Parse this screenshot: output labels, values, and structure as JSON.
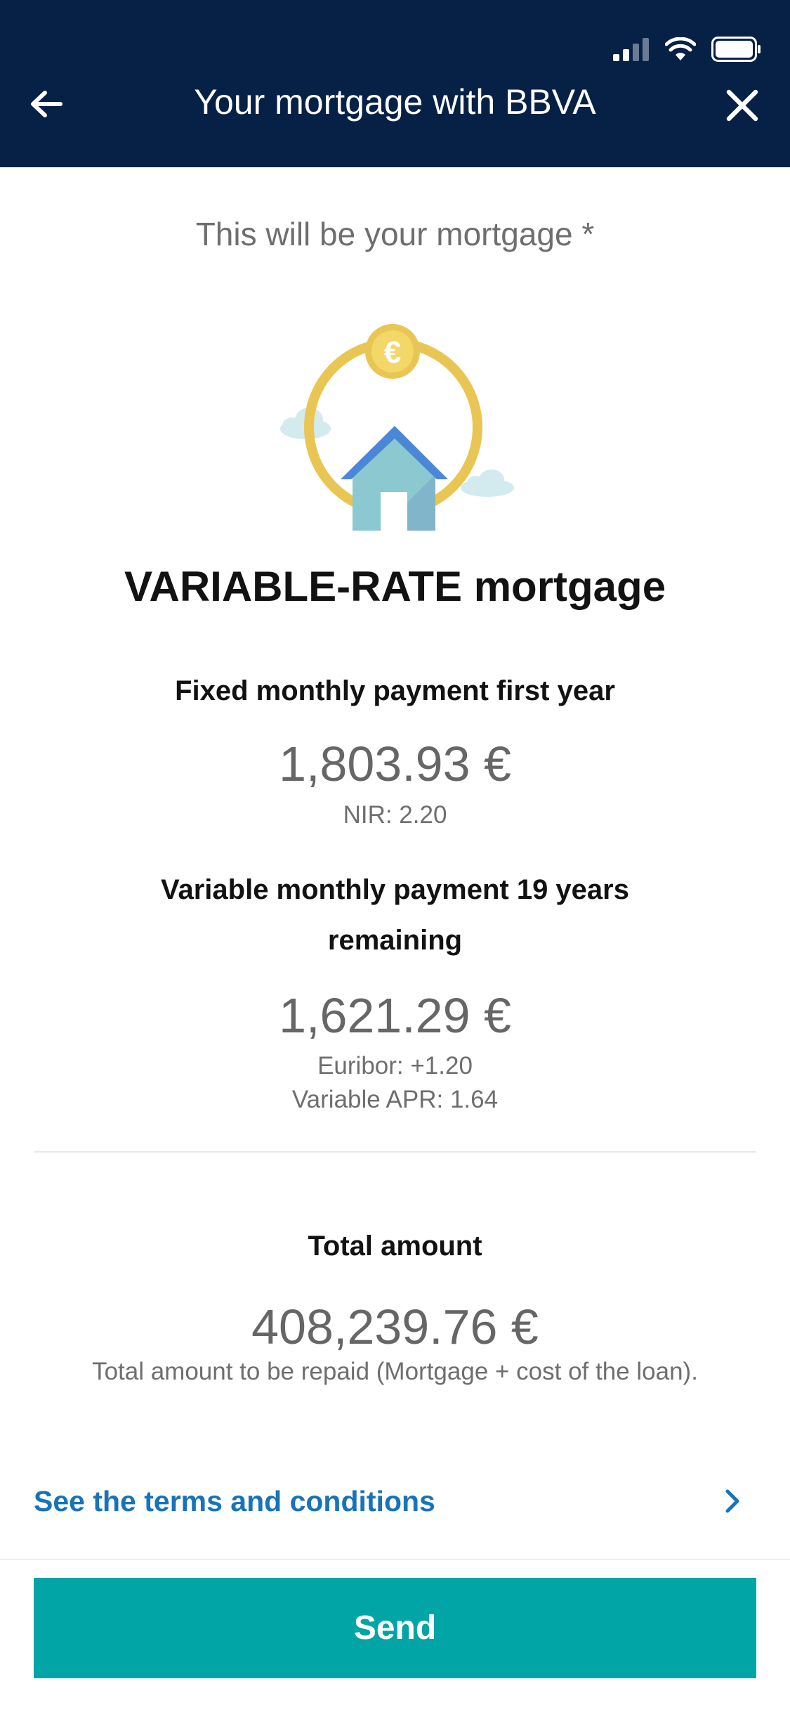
{
  "header": {
    "title": "Your mortgage with BBVA"
  },
  "colors": {
    "header_background": "#072146",
    "accent_teal": "#02a5a5",
    "link_blue": "#1973b8",
    "coin_gold": "#e9c653"
  },
  "icons": {
    "back": "arrow-left-icon",
    "close": "close-icon",
    "terms_chevron": "chevron-right-icon",
    "signal": "cellular-signal-icon",
    "wifi": "wifi-icon",
    "battery": "battery-icon",
    "illustration": "house-euro-coin-illustration"
  },
  "content": {
    "subtitle": "This will be your mortgage *",
    "mortgage_type": "VARIABLE-RATE mortgage",
    "coin_symbol": "€",
    "fixed": {
      "heading": "Fixed monthly payment first year",
      "amount": "1,803.93 €",
      "nir": "NIR: 2.20"
    },
    "variable": {
      "heading": "Variable monthly payment 19 years remaining",
      "amount": "1,621.29 €",
      "euribor": "Euribor: +1.20",
      "apr": "Variable APR: 1.64"
    },
    "total": {
      "heading": "Total amount",
      "amount": "408,239.76 €",
      "note": "Total amount to be repaid (Mortgage + cost of the loan)."
    }
  },
  "links": {
    "terms": "See the terms and conditions"
  },
  "actions": {
    "send": "Send"
  }
}
